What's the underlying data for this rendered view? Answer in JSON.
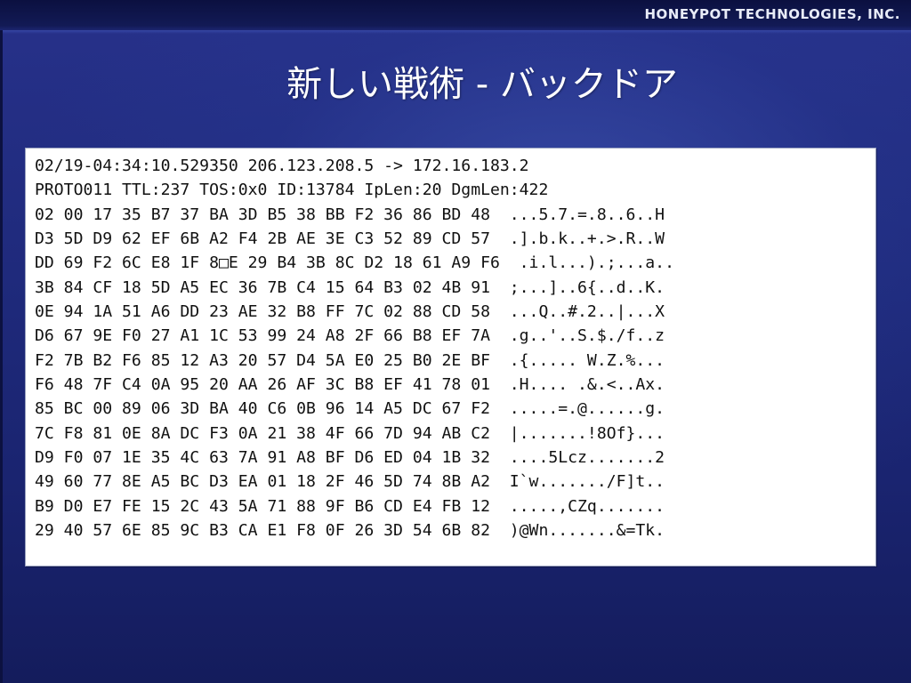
{
  "header": {
    "company": "HONEYPOT TECHNOLOGIES, INC."
  },
  "slide": {
    "title": "新しい戦術 - バックドア"
  },
  "packet_dump": {
    "lines": [
      "02/19-04:34:10.529350 206.123.208.5 -> 172.16.183.2",
      "PROTO011 TTL:237 TOS:0x0 ID:13784 IpLen:20 DgmLen:422",
      "02 00 17 35 B7 37 BA 3D B5 38 BB F2 36 86 BD 48  ...5.7.=.8..6..H",
      "D3 5D D9 62 EF 6B A2 F4 2B AE 3E C3 52 89 CD 57  .].b.k..+.>.R..W",
      "DD 69 F2 6C E8 1F 8□E 29 B4 3B 8C D2 18 61 A9 F6  .i.l...).;...a..",
      "3B 84 CF 18 5D A5 EC 36 7B C4 15 64 B3 02 4B 91  ;...]..6{..d..K.",
      "0E 94 1A 51 A6 DD 23 AE 32 B8 FF 7C 02 88 CD 58  ...Q..#.2..|...X",
      "D6 67 9E F0 27 A1 1C 53 99 24 A8 2F 66 B8 EF 7A  .g..'..S.$./f..z",
      "F2 7B B2 F6 85 12 A3 20 57 D4 5A E0 25 B0 2E BF  .{..... W.Z.%...",
      "F6 48 7F C4 0A 95 20 AA 26 AF 3C B8 EF 41 78 01  .H.... .&.<..Ax.",
      "85 BC 00 89 06 3D BA 40 C6 0B 96 14 A5 DC 67 F2  .....=.@......g.",
      "7C F8 81 0E 8A DC F3 0A 21 38 4F 66 7D 94 AB C2  |.......!8Of}...",
      "D9 F0 07 1E 35 4C 63 7A 91 A8 BF D6 ED 04 1B 32  ....5Lcz.......2",
      "49 60 77 8E A5 BC D3 EA 01 18 2F 46 5D 74 8B A2  I`w......./F]t..",
      "B9 D0 E7 FE 15 2C 43 5A 71 88 9F B6 CD E4 FB 12  .....,CZq.......",
      "29 40 57 6E 85 9C B3 CA E1 F8 0F 26 3D 54 6B 82  )@Wn.......&=Tk."
    ]
  }
}
